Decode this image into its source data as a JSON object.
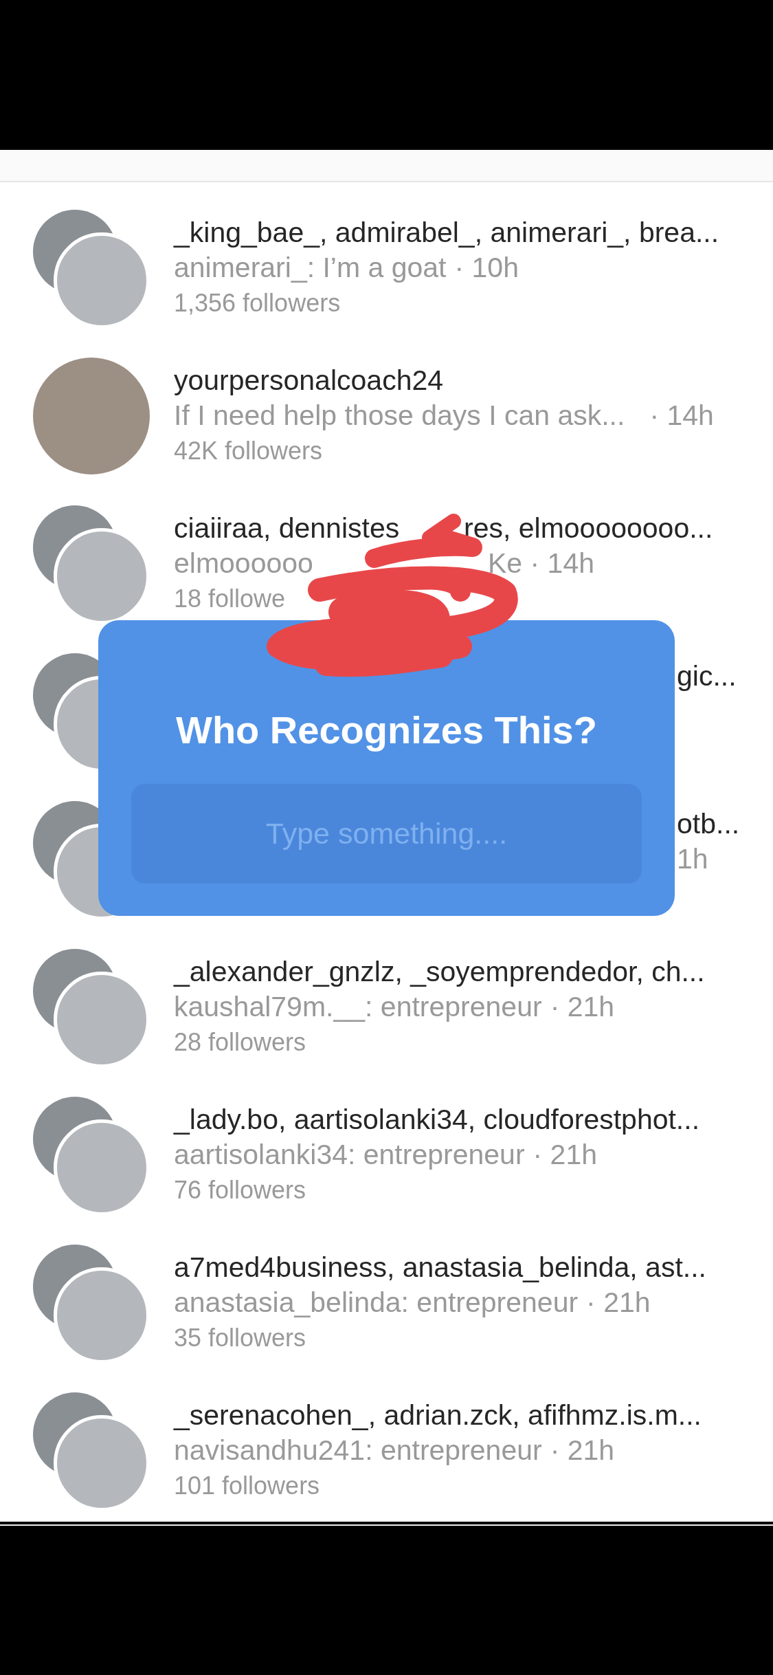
{
  "rows": [
    {
      "kind": "group",
      "title": "_king_bae_, admirabel_, animerari_, brea...",
      "message": "animerari_: I’m a goat",
      "time": "· 10h",
      "followers": "1,356 followers"
    },
    {
      "kind": "person",
      "title": "yourpersonalcoach24",
      "message": "If I need help those days I can ask...",
      "time": "· 14h",
      "followers": "42K followers"
    },
    {
      "kind": "scribbled",
      "title_parts": [
        "ciaiiraa, dennistes",
        "res, elmoooooooo..."
      ],
      "message_parts": [
        "elmoooooo",
        "Ke · 14h"
      ],
      "followers": "18 followe"
    },
    {
      "kind": "covered",
      "title": "gic..."
    },
    {
      "kind": "covered",
      "title": "otb...",
      "time": "1h"
    },
    {
      "kind": "group",
      "title": "_alexander_gnzlz, _soyemprendedor, ch...",
      "message": "kaushal79m.__: entrepreneur",
      "time": "· 21h",
      "followers": "28 followers"
    },
    {
      "kind": "group",
      "title": "_lady.bo, aartisolanki34, cloudforestphot...",
      "message": "aartisolanki34: entrepreneur",
      "time": "· 21h",
      "followers": "76 followers"
    },
    {
      "kind": "group",
      "title": "a7med4business, anastasia_belinda, ast...",
      "message": "anastasia_belinda: entrepreneur",
      "time": "· 21h",
      "followers": "35 followers"
    },
    {
      "kind": "group",
      "title": "_serenacohen_, adrian.zck, afifhmz.is.m...",
      "message": "navisandhu241: entrepreneur",
      "time": "· 21h",
      "followers": "101 followers"
    }
  ],
  "question_card": {
    "title": "Who Recognizes This?",
    "placeholder": "Type something...."
  }
}
